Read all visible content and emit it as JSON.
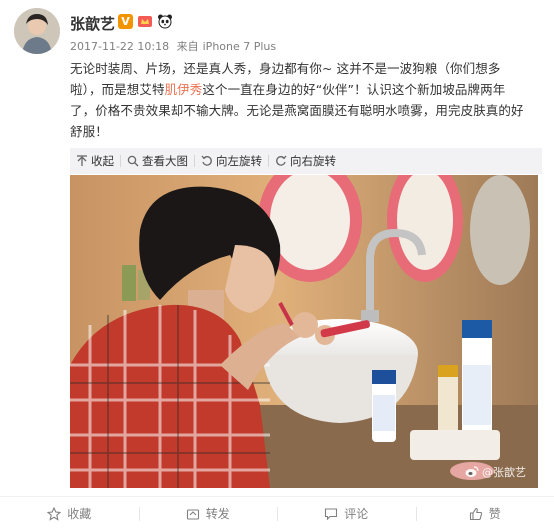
{
  "post": {
    "author": "张歆艺",
    "verified_badge": "V",
    "timestamp": "2017-11-22 10:18",
    "source_prefix": "来自",
    "source_device": "iPhone 7 Plus",
    "content_part1": "无论时装周、片场，还是真人秀，身边都有你~ 这并不是一波狗粮（你们想多啦），而是想艾特",
    "content_highlight": "肌伊秀",
    "content_part2": "这个一直在身边的好“伙伴”！认识这个新加坡品牌两年了，价格不贵效果却不输大牌。无论是燕窝面膜还有聪明水喷雾，用完皮肤真的好舒服！"
  },
  "media_toolbar": {
    "collapse": "收起",
    "view_large": "查看大图",
    "rotate_left": "向左旋转",
    "rotate_right": "向右旋转"
  },
  "image": {
    "watermark": "@张歆艺"
  },
  "actions": {
    "favorite": "收藏",
    "repost": "转发",
    "comment": "评论",
    "like": "赞"
  },
  "colors": {
    "accent": "#eb7350",
    "verified": "#f29400",
    "toolbar_bg": "#f2f2f5",
    "muted_text": "#808080"
  }
}
